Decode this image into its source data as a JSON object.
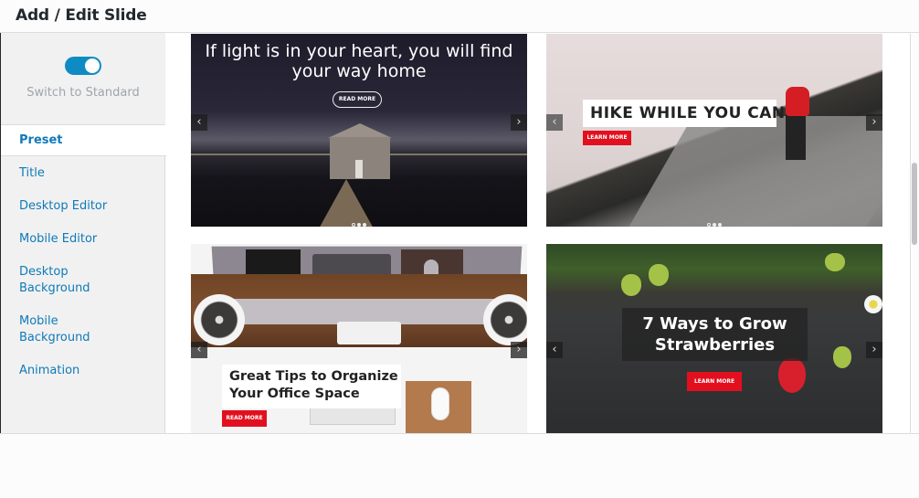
{
  "header": {
    "title": "Add / Edit Slide"
  },
  "mode": {
    "toggle_on": true,
    "label": "Switch to Standard"
  },
  "sidebar": {
    "items": [
      {
        "label": "Preset",
        "active": true
      },
      {
        "label": "Title"
      },
      {
        "label": "Desktop Editor"
      },
      {
        "label": "Mobile Editor"
      },
      {
        "label": "Desktop\nBackground"
      },
      {
        "label": "Mobile\nBackground"
      },
      {
        "label": "Animation"
      }
    ]
  },
  "presets": [
    {
      "title": "If light is in your heart, you will find your way home",
      "button": "READ MORE",
      "dots": 3
    },
    {
      "title": "HIKE WHILE YOU CAN",
      "button": "LEARN MORE",
      "dots": 3
    },
    {
      "title": "Great Tips to Organize Your Office Space",
      "button": "READ MORE"
    },
    {
      "title": "7 Ways to Grow Strawberries",
      "button": "LEARN MORE"
    }
  ],
  "arrows": {
    "prev": "‹",
    "next": "›"
  },
  "colors": {
    "accent": "#0f8bc3",
    "link": "#0f7ab8",
    "button_red": "#e2101f"
  }
}
